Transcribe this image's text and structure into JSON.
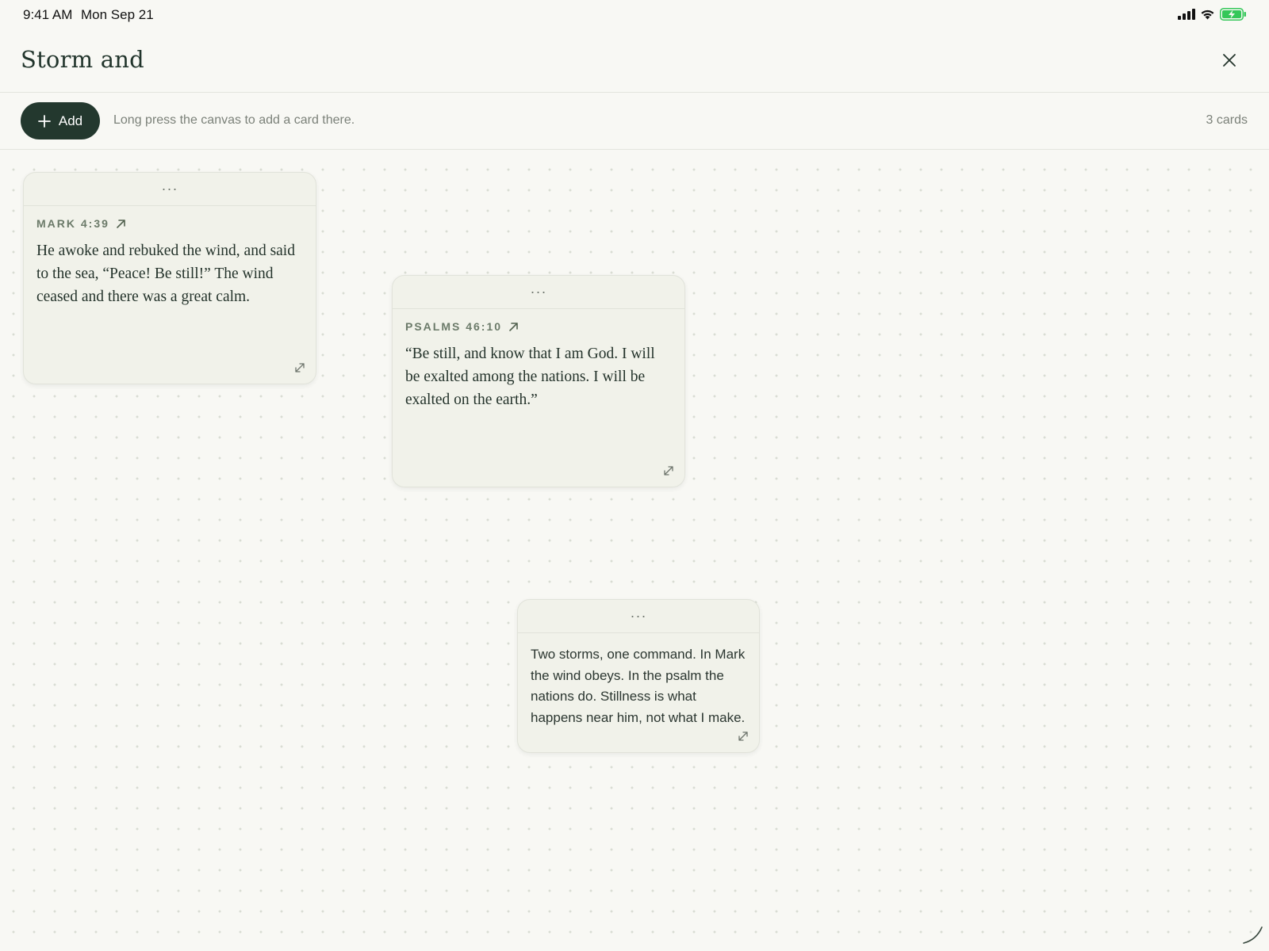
{
  "status_bar": {
    "time": "9:41 AM",
    "date": "Mon Sep 21"
  },
  "header": {
    "title": "Storm and"
  },
  "toolbar": {
    "add_label": "Add",
    "hint": "Long press the canvas to add a card there.",
    "card_count": "3 cards"
  },
  "cards": [
    {
      "menu": "···",
      "reference": "MARK 4:39",
      "text": "He awoke and rebuked the wind, and said to the sea, “Peace! Be still!” The wind ceased and there was a great calm."
    },
    {
      "menu": "···",
      "reference": "PSALMS 46:10",
      "text": "“Be still, and know that I am God. I will be exalted among the nations. I will be exalted on the earth.”"
    },
    {
      "menu": "···",
      "text": "Two storms, one command. In Mark the wind obeys. In the psalm the nations do. Stillness is what happens near him, not what I make."
    }
  ],
  "colors": {
    "background": "#f8f8f4",
    "accent": "#23382e",
    "card": "#f1f2ea",
    "battery": "#34c759"
  },
  "icons": [
    "signal-icon",
    "wifi-icon",
    "battery-charging-icon",
    "close-icon",
    "plus-icon",
    "external-link-icon",
    "resize-icon",
    "pencil-corner-icon"
  ]
}
